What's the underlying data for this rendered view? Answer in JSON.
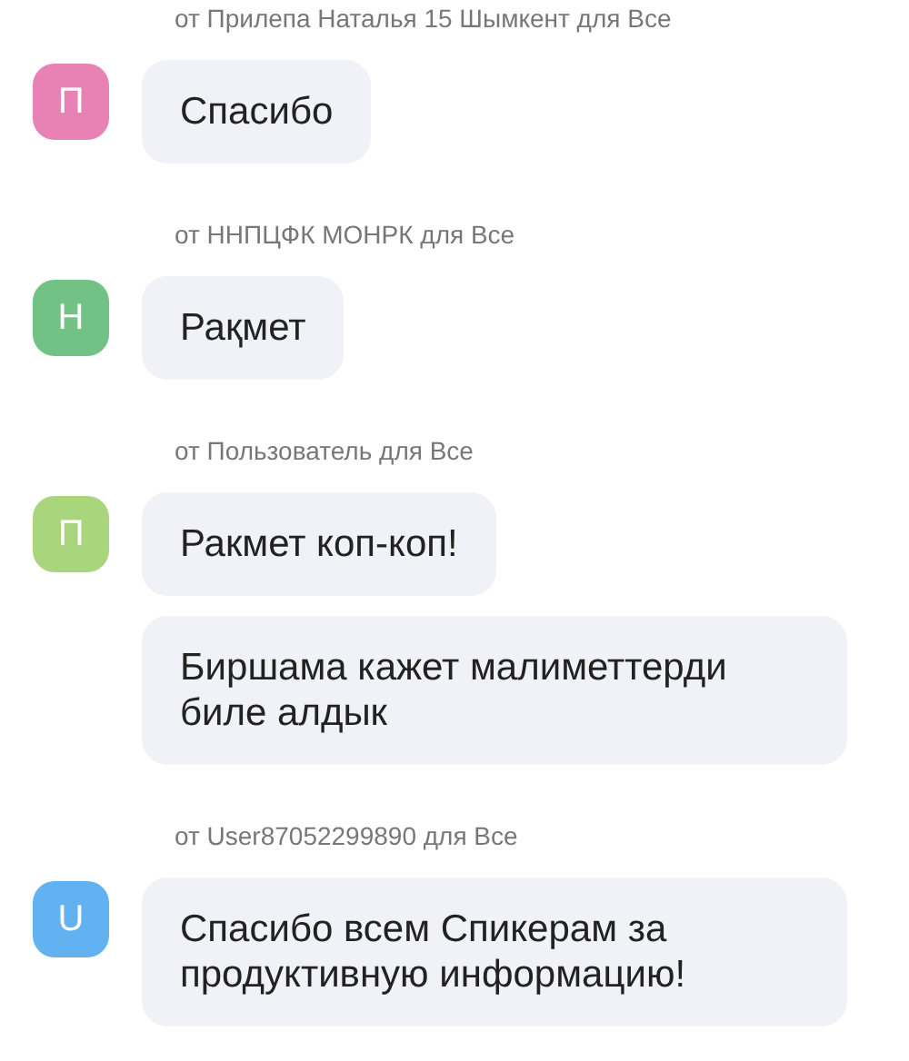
{
  "messages": [
    {
      "header": "от Прилепа Наталья 15 Шымкент для Все",
      "avatar": {
        "letter": "П",
        "color": "#e882b4"
      },
      "bubbles": [
        "Спасибо"
      ]
    },
    {
      "header": "от ННПЦФК МОНРК для Все",
      "avatar": {
        "letter": "Н",
        "color": "#72c286"
      },
      "bubbles": [
        "Рақмет"
      ]
    },
    {
      "header": "от Пользователь для Все",
      "avatar": {
        "letter": "П",
        "color": "#a9d57c"
      },
      "bubbles": [
        "Ракмет коп-коп!",
        "Биршама кажет малиметтерди биле алдык"
      ]
    },
    {
      "header": "от User87052299890 для Все",
      "avatar": {
        "letter": "U",
        "color": "#62b1f0"
      },
      "bubbles": [
        "Спасибо всем Спикерам за продуктивную информацию!"
      ]
    }
  ]
}
